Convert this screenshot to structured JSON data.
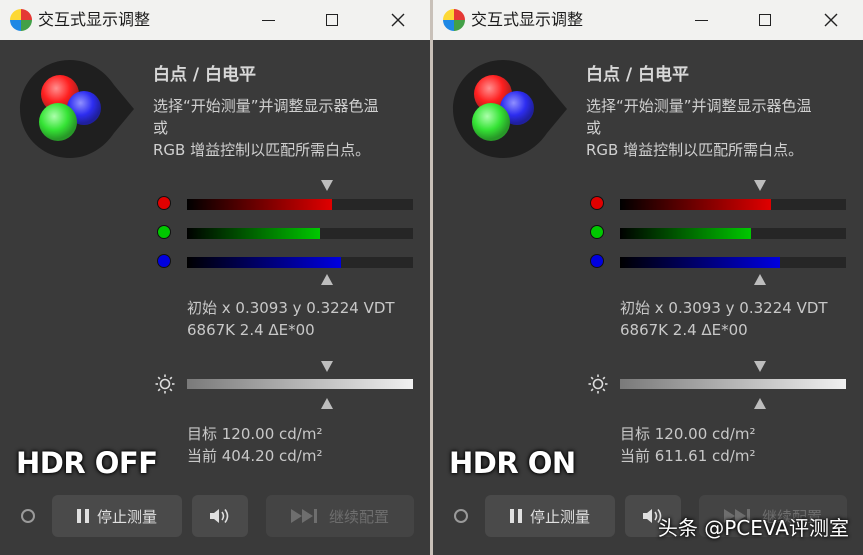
{
  "colors": {
    "red": "#e00000",
    "green": "#00c800",
    "blue": "#0000e0",
    "panel": "#3a3a3a",
    "titlebar": "#f2f2f0"
  },
  "windows": [
    {
      "title": "交互式显示调整",
      "heading": "白点 / 白电平",
      "description": [
        "选择“开始测量”并调整显示器色温",
        "或",
        "RGB 增益控制以匹配所需白点。"
      ],
      "channels": [
        {
          "name": "red",
          "level": 0.64
        },
        {
          "name": "green",
          "level": 0.59
        },
        {
          "name": "blue",
          "level": 0.68
        }
      ],
      "reading": {
        "line1": "初始 x 0.3093 y 0.3224 VDT",
        "line2": "6867K 2.4 ΔE*00"
      },
      "target_label": "目标 120.00 cd/m²",
      "current_label": "当前 404.20 cd/m²",
      "overlay": "HDR OFF",
      "buttons": {
        "stop": "停止测量",
        "continue": "继续配置"
      },
      "icons": [
        "restore-icon",
        "minimize-icon",
        "maximize-icon",
        "close-icon",
        "brightness-icon",
        "pause-icon",
        "speaker-icon",
        "skip-icon"
      ]
    },
    {
      "title": "交互式显示调整",
      "heading": "白点 / 白电平",
      "description": [
        "选择“开始测量”并调整显示器色温",
        "或",
        "RGB 增益控制以匹配所需白点。"
      ],
      "channels": [
        {
          "name": "red",
          "level": 0.67
        },
        {
          "name": "green",
          "level": 0.58
        },
        {
          "name": "blue",
          "level": 0.71
        }
      ],
      "reading": {
        "line1": "初始 x 0.3093 y 0.3224 VDT",
        "line2": "6867K 2.4 ΔE*00"
      },
      "target_label": "目标 120.00 cd/m²",
      "current_label": "当前 611.61 cd/m²",
      "overlay": "HDR ON",
      "buttons": {
        "stop": "停止测量",
        "continue": "继续配置"
      }
    }
  ],
  "watermark": "头条 @PCEVA评测室"
}
